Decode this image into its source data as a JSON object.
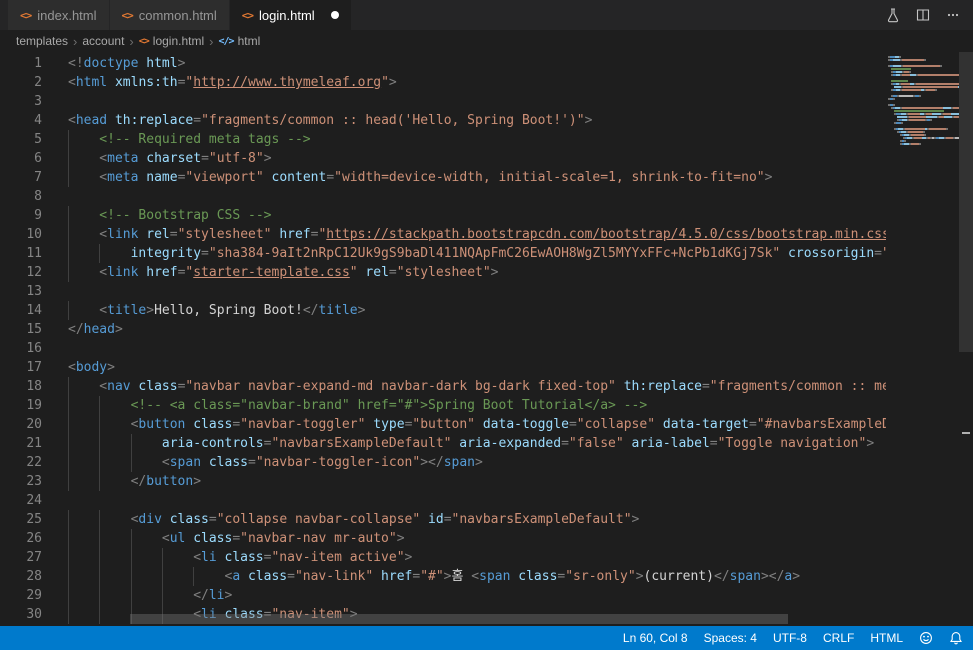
{
  "colors": {
    "accent": "#007acc",
    "editor_bg": "#1e1e1e",
    "tabbar_bg": "#252526",
    "html_icon": "#e37933",
    "string": "#ce9178",
    "tag": "#569cd6",
    "attr": "#9cdcfe",
    "comment": "#6a9955"
  },
  "icon_glyphs": {
    "html-file-icon": "<>",
    "symbol-element-icon": "</>"
  },
  "tab_bar": {
    "tabs": [
      {
        "label": "index.html",
        "active": false,
        "modified": false
      },
      {
        "label": "common.html",
        "active": false,
        "modified": false
      },
      {
        "label": "login.html",
        "active": true,
        "modified": true
      }
    ],
    "actions": [
      "beaker-icon",
      "split-editor-icon",
      "more-actions-icon"
    ]
  },
  "breadcrumb": {
    "items": [
      {
        "label": "templates",
        "icon": null
      },
      {
        "label": "account",
        "icon": null
      },
      {
        "label": "login.html",
        "icon": "html-file-icon"
      },
      {
        "label": "html",
        "icon": "symbol-element-icon"
      }
    ]
  },
  "editor": {
    "lines": [
      {
        "n": 1,
        "indent": 0,
        "tokens": [
          [
            "p",
            "<!"
          ],
          [
            "t",
            "doctype"
          ],
          [
            "a",
            " html"
          ],
          [
            "p",
            ">"
          ]
        ]
      },
      {
        "n": 2,
        "indent": 0,
        "tokens": [
          [
            "p",
            "<"
          ],
          [
            "t",
            "html"
          ],
          [
            "a",
            " xmlns:th"
          ],
          [
            "p",
            "="
          ],
          [
            "s",
            "\""
          ],
          [
            "u",
            "http://www.thymeleaf.org"
          ],
          [
            "s",
            "\""
          ],
          [
            "p",
            ">"
          ]
        ]
      },
      {
        "n": 3,
        "indent": 0,
        "tokens": []
      },
      {
        "n": 4,
        "indent": 0,
        "tokens": [
          [
            "p",
            "<"
          ],
          [
            "t",
            "head"
          ],
          [
            "a",
            " th:replace"
          ],
          [
            "p",
            "="
          ],
          [
            "s",
            "\"fragments/common :: head('Hello, Spring Boot!')\""
          ],
          [
            "p",
            ">"
          ]
        ]
      },
      {
        "n": 5,
        "indent": 1,
        "tokens": [
          [
            "c",
            "<!-- Required meta tags -->"
          ]
        ]
      },
      {
        "n": 6,
        "indent": 1,
        "tokens": [
          [
            "p",
            "<"
          ],
          [
            "t",
            "meta"
          ],
          [
            "a",
            " charset"
          ],
          [
            "p",
            "="
          ],
          [
            "s",
            "\"utf-8\""
          ],
          [
            "p",
            ">"
          ]
        ]
      },
      {
        "n": 7,
        "indent": 1,
        "tokens": [
          [
            "p",
            "<"
          ],
          [
            "t",
            "meta"
          ],
          [
            "a",
            " name"
          ],
          [
            "p",
            "="
          ],
          [
            "s",
            "\"viewport\""
          ],
          [
            "a",
            " content"
          ],
          [
            "p",
            "="
          ],
          [
            "s",
            "\"width=device-width, initial-scale=1, shrink-to-fit=no\""
          ],
          [
            "p",
            ">"
          ]
        ]
      },
      {
        "n": 8,
        "indent": 0,
        "tokens": []
      },
      {
        "n": 9,
        "indent": 1,
        "tokens": [
          [
            "c",
            "<!-- Bootstrap CSS -->"
          ]
        ]
      },
      {
        "n": 10,
        "indent": 1,
        "tokens": [
          [
            "p",
            "<"
          ],
          [
            "t",
            "link"
          ],
          [
            "a",
            " rel"
          ],
          [
            "p",
            "="
          ],
          [
            "s",
            "\"stylesheet\""
          ],
          [
            "a",
            " href"
          ],
          [
            "p",
            "="
          ],
          [
            "s",
            "\""
          ],
          [
            "u",
            "https://stackpath.bootstrapcdn.com/bootstrap/4.5.0/css/bootstrap.min.css"
          ],
          [
            "s",
            "\""
          ]
        ]
      },
      {
        "n": 11,
        "indent": 2,
        "tokens": [
          [
            "a",
            "integrity"
          ],
          [
            "p",
            "="
          ],
          [
            "s",
            "\"sha384-9aIt2nRpC12Uk9gS9baDl411NQApFmC26EwAOH8WgZl5MYYxFFc+NcPb1dKGj7Sk\""
          ],
          [
            "a",
            " crossorigin"
          ],
          [
            "p",
            "="
          ],
          [
            "s",
            "\"anonymous\""
          ],
          [
            "p",
            ">"
          ]
        ]
      },
      {
        "n": 12,
        "indent": 1,
        "tokens": [
          [
            "p",
            "<"
          ],
          [
            "t",
            "link"
          ],
          [
            "a",
            " href"
          ],
          [
            "p",
            "="
          ],
          [
            "s",
            "\""
          ],
          [
            "u",
            "starter-template.css"
          ],
          [
            "s",
            "\""
          ],
          [
            "a",
            " rel"
          ],
          [
            "p",
            "="
          ],
          [
            "s",
            "\"stylesheet\""
          ],
          [
            "p",
            ">"
          ]
        ]
      },
      {
        "n": 13,
        "indent": 0,
        "tokens": []
      },
      {
        "n": 14,
        "indent": 1,
        "tokens": [
          [
            "p",
            "<"
          ],
          [
            "t",
            "title"
          ],
          [
            "p",
            ">"
          ],
          [
            "x",
            "Hello, Spring Boot!"
          ],
          [
            "p",
            "</"
          ],
          [
            "t",
            "title"
          ],
          [
            "p",
            ">"
          ]
        ]
      },
      {
        "n": 15,
        "indent": 0,
        "tokens": [
          [
            "p",
            "</"
          ],
          [
            "t",
            "head"
          ],
          [
            "p",
            ">"
          ]
        ]
      },
      {
        "n": 16,
        "indent": 0,
        "tokens": []
      },
      {
        "n": 17,
        "indent": 0,
        "tokens": [
          [
            "p",
            "<"
          ],
          [
            "t",
            "body"
          ],
          [
            "p",
            ">"
          ]
        ]
      },
      {
        "n": 18,
        "indent": 1,
        "tokens": [
          [
            "p",
            "<"
          ],
          [
            "t",
            "nav"
          ],
          [
            "a",
            " class"
          ],
          [
            "p",
            "="
          ],
          [
            "s",
            "\"navbar navbar-expand-md navbar-dark bg-dark fixed-top\""
          ],
          [
            "a",
            " th:replace"
          ],
          [
            "p",
            "="
          ],
          [
            "s",
            "\"fragments/common :: menu('login')\""
          ],
          [
            "p",
            ">"
          ]
        ]
      },
      {
        "n": 19,
        "indent": 2,
        "tokens": [
          [
            "c",
            "<!-- <a class=\"navbar-brand\" href=\"#\">Spring Boot Tutorial</a> -->"
          ]
        ]
      },
      {
        "n": 20,
        "indent": 2,
        "tokens": [
          [
            "p",
            "<"
          ],
          [
            "t",
            "button"
          ],
          [
            "a",
            " class"
          ],
          [
            "p",
            "="
          ],
          [
            "s",
            "\"navbar-toggler\""
          ],
          [
            "a",
            " type"
          ],
          [
            "p",
            "="
          ],
          [
            "s",
            "\"button\""
          ],
          [
            "a",
            " data-toggle"
          ],
          [
            "p",
            "="
          ],
          [
            "s",
            "\"collapse\""
          ],
          [
            "a",
            " data-target"
          ],
          [
            "p",
            "="
          ],
          [
            "s",
            "\"#navbarsExampleDefault\""
          ]
        ]
      },
      {
        "n": 21,
        "indent": 3,
        "tokens": [
          [
            "a",
            "aria-controls"
          ],
          [
            "p",
            "="
          ],
          [
            "s",
            "\"navbarsExampleDefault\""
          ],
          [
            "a",
            " aria-expanded"
          ],
          [
            "p",
            "="
          ],
          [
            "s",
            "\"false\""
          ],
          [
            "a",
            " aria-label"
          ],
          [
            "p",
            "="
          ],
          [
            "s",
            "\"Toggle navigation\""
          ],
          [
            "p",
            ">"
          ]
        ]
      },
      {
        "n": 22,
        "indent": 3,
        "tokens": [
          [
            "p",
            "<"
          ],
          [
            "t",
            "span"
          ],
          [
            "a",
            " class"
          ],
          [
            "p",
            "="
          ],
          [
            "s",
            "\"navbar-toggler-icon\""
          ],
          [
            "p",
            "></"
          ],
          [
            "t",
            "span"
          ],
          [
            "p",
            ">"
          ]
        ]
      },
      {
        "n": 23,
        "indent": 2,
        "tokens": [
          [
            "p",
            "</"
          ],
          [
            "t",
            "button"
          ],
          [
            "p",
            ">"
          ]
        ]
      },
      {
        "n": 24,
        "indent": 0,
        "tokens": []
      },
      {
        "n": 25,
        "indent": 2,
        "tokens": [
          [
            "p",
            "<"
          ],
          [
            "t",
            "div"
          ],
          [
            "a",
            " class"
          ],
          [
            "p",
            "="
          ],
          [
            "s",
            "\"collapse navbar-collapse\""
          ],
          [
            "a",
            " id"
          ],
          [
            "p",
            "="
          ],
          [
            "s",
            "\"navbarsExampleDefault\""
          ],
          [
            "p",
            ">"
          ]
        ]
      },
      {
        "n": 26,
        "indent": 3,
        "tokens": [
          [
            "p",
            "<"
          ],
          [
            "t",
            "ul"
          ],
          [
            "a",
            " class"
          ],
          [
            "p",
            "="
          ],
          [
            "s",
            "\"navbar-nav mr-auto\""
          ],
          [
            "p",
            ">"
          ]
        ]
      },
      {
        "n": 27,
        "indent": 4,
        "tokens": [
          [
            "p",
            "<"
          ],
          [
            "t",
            "li"
          ],
          [
            "a",
            " class"
          ],
          [
            "p",
            "="
          ],
          [
            "s",
            "\"nav-item active\""
          ],
          [
            "p",
            ">"
          ]
        ]
      },
      {
        "n": 28,
        "indent": 5,
        "tokens": [
          [
            "p",
            "<"
          ],
          [
            "t",
            "a"
          ],
          [
            "a",
            " class"
          ],
          [
            "p",
            "="
          ],
          [
            "s",
            "\"nav-link\""
          ],
          [
            "a",
            " href"
          ],
          [
            "p",
            "="
          ],
          [
            "s",
            "\"#\""
          ],
          [
            "p",
            ">"
          ],
          [
            "x",
            "홈 "
          ],
          [
            "p",
            "<"
          ],
          [
            "t",
            "span"
          ],
          [
            "a",
            " class"
          ],
          [
            "p",
            "="
          ],
          [
            "s",
            "\"sr-only\""
          ],
          [
            "p",
            ">"
          ],
          [
            "x",
            "(current)"
          ],
          [
            "p",
            "</"
          ],
          [
            "t",
            "span"
          ],
          [
            "p",
            "></"
          ],
          [
            "t",
            "a"
          ],
          [
            "p",
            ">"
          ]
        ]
      },
      {
        "n": 29,
        "indent": 4,
        "tokens": [
          [
            "p",
            "</"
          ],
          [
            "t",
            "li"
          ],
          [
            "p",
            ">"
          ]
        ]
      },
      {
        "n": 30,
        "indent": 4,
        "tokens": [
          [
            "p",
            "<"
          ],
          [
            "t",
            "li"
          ],
          [
            "a",
            " class"
          ],
          [
            "p",
            "="
          ],
          [
            "s",
            "\"nav-item\""
          ],
          [
            "p",
            ">"
          ]
        ]
      }
    ]
  },
  "status_bar": {
    "items": [
      {
        "label": "Ln 60, Col 8",
        "name": "cursor-position"
      },
      {
        "label": "Spaces: 4",
        "name": "indentation-setting"
      },
      {
        "label": "UTF-8",
        "name": "encoding"
      },
      {
        "label": "CRLF",
        "name": "eol-sequence"
      },
      {
        "label": "HTML",
        "name": "language-mode"
      }
    ]
  }
}
